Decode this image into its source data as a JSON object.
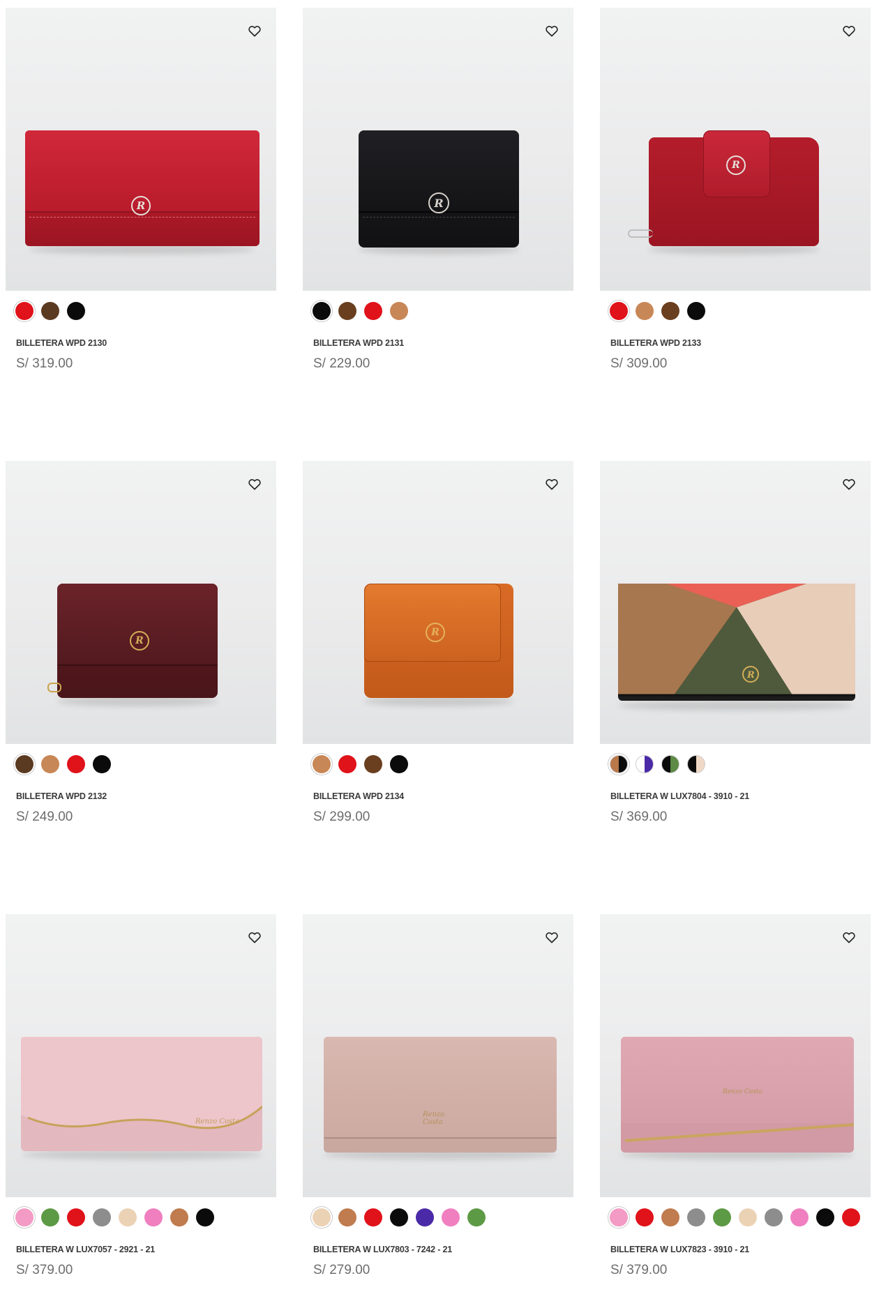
{
  "products": [
    {
      "name": "BILLETERA WPD 2130",
      "price": "S/ 319.00",
      "wishlist_icon": "heart-outline-icon",
      "image_label": "red long leather wallet",
      "colors": [
        "#e0121a",
        "#5b3a22",
        "#0b0b0b"
      ],
      "selected": 0
    },
    {
      "name": "BILLETERA WPD 2131",
      "price": "S/ 229.00",
      "wishlist_icon": "heart-outline-icon",
      "image_label": "black trifold leather wallet",
      "colors": [
        "#0b0b0b",
        "#6a3f1f",
        "#e0121a",
        "#c88756"
      ],
      "selected": 0
    },
    {
      "name": "BILLETERA WPD 2133",
      "price": "S/ 309.00",
      "wishlist_icon": "heart-outline-icon",
      "image_label": "red wallet with snap tab",
      "colors": [
        "#e0121a",
        "#c88756",
        "#6a3f1f",
        "#0b0b0b"
      ],
      "selected": 0
    },
    {
      "name": "BILLETERA WPD 2132",
      "price": "S/ 249.00",
      "wishlist_icon": "heart-outline-icon",
      "image_label": "brown burgundy compact wallet",
      "colors": [
        "#5b3a22",
        "#c88756",
        "#e0121a",
        "#0b0b0b"
      ],
      "selected": 0
    },
    {
      "name": "BILLETERA WPD 2134",
      "price": "S/ 299.00",
      "wishlist_icon": "heart-outline-icon",
      "image_label": "orange compact wallet",
      "colors": [
        "#c88756",
        "#e0121a",
        "#6a3f1f",
        "#0b0b0b"
      ],
      "selected": 0
    },
    {
      "name": "BILLETERA W LUX7804 - 3910 - 21",
      "price": "S/ 369.00",
      "wishlist_icon": "heart-outline-icon",
      "image_label": "patchwork long wallet",
      "colors": [
        [
          "#b8784a",
          "#0b0b0b"
        ],
        [
          "#ffffff",
          "#4b2aa8"
        ],
        [
          "#0b0b0b",
          "#5d8a45"
        ],
        [
          "#0b0b0b",
          "#f0d9c4"
        ]
      ],
      "selected": 0
    },
    {
      "name": "BILLETERA W LUX7057 - 2921 - 21",
      "price": "S/ 379.00",
      "wishlist_icon": "heart-outline-icon",
      "image_label": "pink long wallet with gold wave",
      "colors": [
        "#f39bc4",
        "#5d9a45",
        "#e0121a",
        "#8d8d8d",
        "#ecd2b5",
        "#f07fc0",
        "#c07b4e",
        "#0b0b0b"
      ],
      "selected": 0
    },
    {
      "name": "BILLETERA W LUX7803 - 7242 - 21",
      "price": "S/ 279.00",
      "wishlist_icon": "heart-outline-icon",
      "image_label": "nude long wallet",
      "colors": [
        "#ecd2b5",
        "#c07b4e",
        "#e0121a",
        "#0b0b0b",
        "#4b2aa8",
        "#f07fc0",
        "#5d9a45"
      ],
      "selected": 0
    },
    {
      "name": "BILLETERA W LUX7823 - 3910 - 21",
      "price": "S/ 379.00",
      "wishlist_icon": "heart-outline-icon",
      "image_label": "dusty pink long wallet with gold bar",
      "colors": [
        "#f39bc4",
        "#e0121a",
        "#c07b4e",
        "#8d8d8d",
        "#5d9a45",
        "#ecd2b5",
        "#8d8d8d",
        "#f07fc0",
        "#0b0b0b",
        "#e0121a"
      ],
      "selected": 0
    }
  ]
}
